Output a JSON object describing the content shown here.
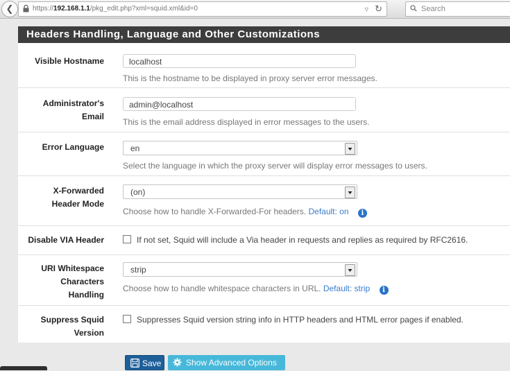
{
  "browser": {
    "url_prefix": "https://",
    "url_host": "192.168.1.1",
    "url_path": "/pkg_edit.php?xml=squid.xml&id=0",
    "search_placeholder": "Search"
  },
  "panel": {
    "title": "Headers Handling, Language and Other Customizations"
  },
  "fields": {
    "visible_hostname": {
      "label": "Visible Hostname",
      "value": "localhost",
      "help": "This is the hostname to be displayed in proxy server error messages."
    },
    "admin_email": {
      "label_line1": "Administrator's",
      "label_line2": "Email",
      "value": "admin@localhost",
      "help": "This is the email address displayed in error messages to the users."
    },
    "error_language": {
      "label": "Error Language",
      "value": "en",
      "help": "Select the language in which the proxy server will display error messages to users."
    },
    "x_forwarded": {
      "label_line1": "X-Forwarded",
      "label_line2": "Header Mode",
      "value": "(on)",
      "help": "Choose how to handle X-Forwarded-For headers.",
      "default": "Default: on"
    },
    "disable_via": {
      "label": "Disable VIA Header",
      "help": "If not set, Squid will include a Via header in requests and replies as required by RFC2616."
    },
    "uri_whitespace": {
      "label_line1": "URI Whitespace",
      "label_line2": "Characters",
      "label_line3": "Handling",
      "value": "strip",
      "help": "Choose how to handle whitespace characters in URL.",
      "default": "Default: strip"
    },
    "suppress_version": {
      "label_line1": "Suppress Squid",
      "label_line2": "Version",
      "help": "Suppresses Squid version string info in HTTP headers and HTML error pages if enabled."
    }
  },
  "buttons": {
    "save": "Save",
    "advanced": "Show Advanced Options"
  },
  "colors": {
    "panel_heading": "#3d3d3d",
    "save_button": "#1e5f9a",
    "advanced_button": "#2bb0d7",
    "info_icon": "#2a74c8"
  }
}
